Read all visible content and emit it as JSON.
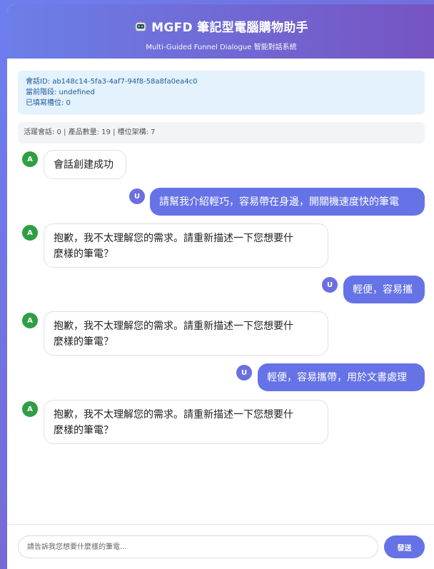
{
  "header": {
    "title": "MGFD 筆記型電腦購物助手",
    "subtitle": "Multi-Guided Funnel Dialogue 智能對話系統",
    "icon": "robot-icon"
  },
  "session": {
    "id_line": "會話ID: ab148c14-5fa3-4af7-94f8-58a8fa0ea4c0",
    "stage_line": "當前階段: undefined",
    "slots_line": "已填寫槽位: 0"
  },
  "stats": {
    "text": "活躍會話: 0 | 產品數量: 19 | 槽位架構: 7"
  },
  "messages": [
    {
      "role": "assistant",
      "avatar": "A",
      "text": "會話創建成功"
    },
    {
      "role": "user",
      "avatar": "U",
      "text": "請幫我介紹輕巧，容易帶在身邊，開關機速度快的筆電"
    },
    {
      "role": "assistant",
      "avatar": "A",
      "line1": "抱歉，我不太理解您的需求。請重新描述一下您想要什",
      "line2": "麼樣的筆電？"
    },
    {
      "role": "user",
      "avatar": "U",
      "text": "輕便，容易攜"
    },
    {
      "role": "assistant",
      "avatar": "A",
      "line1": "抱歉，我不太理解您的需求。請重新描述一下您想要什",
      "line2": "麼樣的筆電？"
    },
    {
      "role": "user",
      "avatar": "U",
      "text": "輕便，容易攜帶，用於文書處理"
    },
    {
      "role": "assistant",
      "avatar": "A",
      "line1": "抱歉，我不太理解您的需求。請重新描述一下您想要什",
      "line2": "麼樣的筆電？"
    }
  ],
  "input": {
    "placeholder": "請告訴我您想要什麼樣的筆電...",
    "value": ""
  },
  "send_button": {
    "label": "發送"
  },
  "colors": {
    "accent": "#6673e6",
    "assistant_avatar": "#2f9e44",
    "header_gradient_start": "#6b7fe8",
    "header_gradient_end": "#7654c2",
    "session_bg": "#e3f2fd"
  }
}
